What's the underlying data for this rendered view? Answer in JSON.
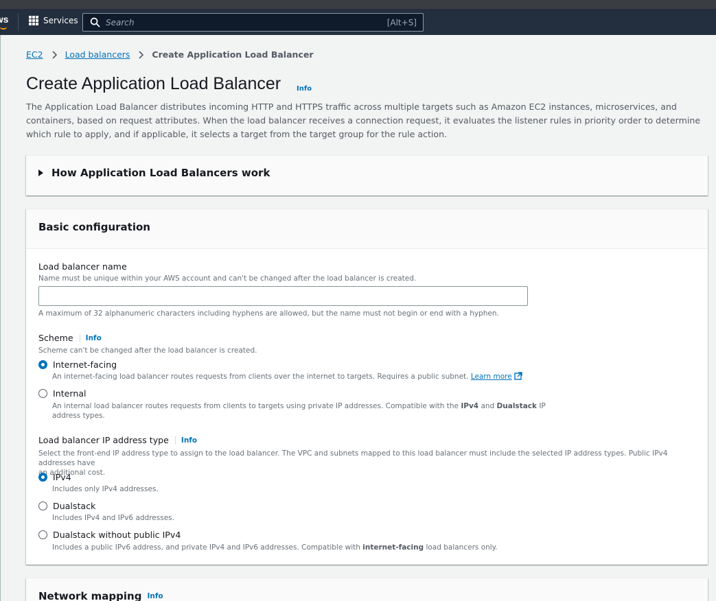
{
  "nav": {
    "logo_text": "aws",
    "services_label": "Services",
    "search_placeholder": "Search",
    "search_shortcut": "[Alt+S]"
  },
  "breadcrumb": {
    "items": [
      "EC2",
      "Load balancers"
    ],
    "current": "Create Application Load Balancer"
  },
  "page": {
    "title": "Create Application Load Balancer",
    "info": "Info",
    "description": "The Application Load Balancer distributes incoming HTTP and HTTPS traffic across multiple targets such as Amazon EC2 instances, microservices, and containers, based on request attributes. When the load balancer receives a connection request, it evaluates the listener rules in priority order to determine which rule to apply, and if applicable, it selects a target from the target group for the rule action."
  },
  "how_section": {
    "title": "How Application Load Balancers work"
  },
  "basic_config": {
    "title": "Basic configuration",
    "name_label": "Load balancer name",
    "name_desc": "Name must be unique within your AWS account and can't be changed after the load balancer is created.",
    "name_value": "",
    "name_constraint": "A maximum of 32 alphanumeric characters including hyphens are allowed, but the name must not begin or end with a hyphen.",
    "scheme_label": "Scheme",
    "scheme_info": "Info",
    "scheme_desc": "Scheme can't be changed after the load balancer is created.",
    "scheme_options": [
      {
        "label": "Internet-facing",
        "desc": "An internet-facing load balancer routes requests from clients over the internet to targets. Requires a public subnet.",
        "link": "Learn more",
        "checked": true
      },
      {
        "label": "Internal",
        "desc_a": "An internal load balancer routes requests from clients to targets using private IP addresses. Compatible with the ",
        "desc_b1": "IPv4",
        "desc_and": " and ",
        "desc_b2": "Dualstack",
        "desc_c": " IP",
        "desc_d": "address types.",
        "checked": false
      }
    ],
    "ip_label": "Load balancer IP address type",
    "ip_info": "Info",
    "ip_desc_1": "Select the front-end IP address type to assign to the load balancer. The VPC and subnets mapped to this load balancer must include the selected IP address types. Public IPv4 addresses have",
    "ip_desc_2": "an additional cost.",
    "ip_options": [
      {
        "label": "IPv4",
        "desc": "Includes only IPv4 addresses.",
        "checked": true
      },
      {
        "label": "Dualstack",
        "desc": "Includes IPv4 and IPv6 addresses.",
        "checked": false
      },
      {
        "label": "Dualstack without public IPv4",
        "desc_a": "Includes a public IPv6 address, and private IPv4 and IPv6 addresses. Compatible with ",
        "desc_b": "internet-facing",
        "desc_c": " load balancers only.",
        "checked": false
      }
    ]
  },
  "network": {
    "title": "Network mapping",
    "info": "Info"
  },
  "colors": {
    "accent": "#0073bb",
    "nav_bg": "#232f3e",
    "page_bg": "#f2f3f3"
  }
}
